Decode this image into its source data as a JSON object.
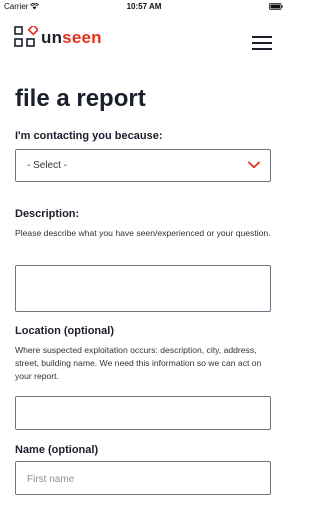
{
  "status_bar": {
    "carrier": "Carrier",
    "time": "10:57 AM"
  },
  "header": {
    "logo_main": "un",
    "logo_accent": "seen",
    "menu_icon": "hamburger-icon"
  },
  "page": {
    "title": "file a report"
  },
  "form": {
    "reason": {
      "label": "I'm contacting you because:",
      "selected": "- Select -"
    },
    "description": {
      "label": "Description:",
      "helper": "Please describe what you have seen/experienced or your question.",
      "value": ""
    },
    "location": {
      "label": "Location (optional)",
      "helper": "Where suspected exploitation occurs: description, city, address, street, building name. We need this information so we can act on your report.",
      "value": ""
    },
    "name": {
      "label": "Name (optional)",
      "placeholder": "First name"
    }
  },
  "colors": {
    "brand_dark": "#1a1f2b",
    "accent": "#e0321c"
  }
}
